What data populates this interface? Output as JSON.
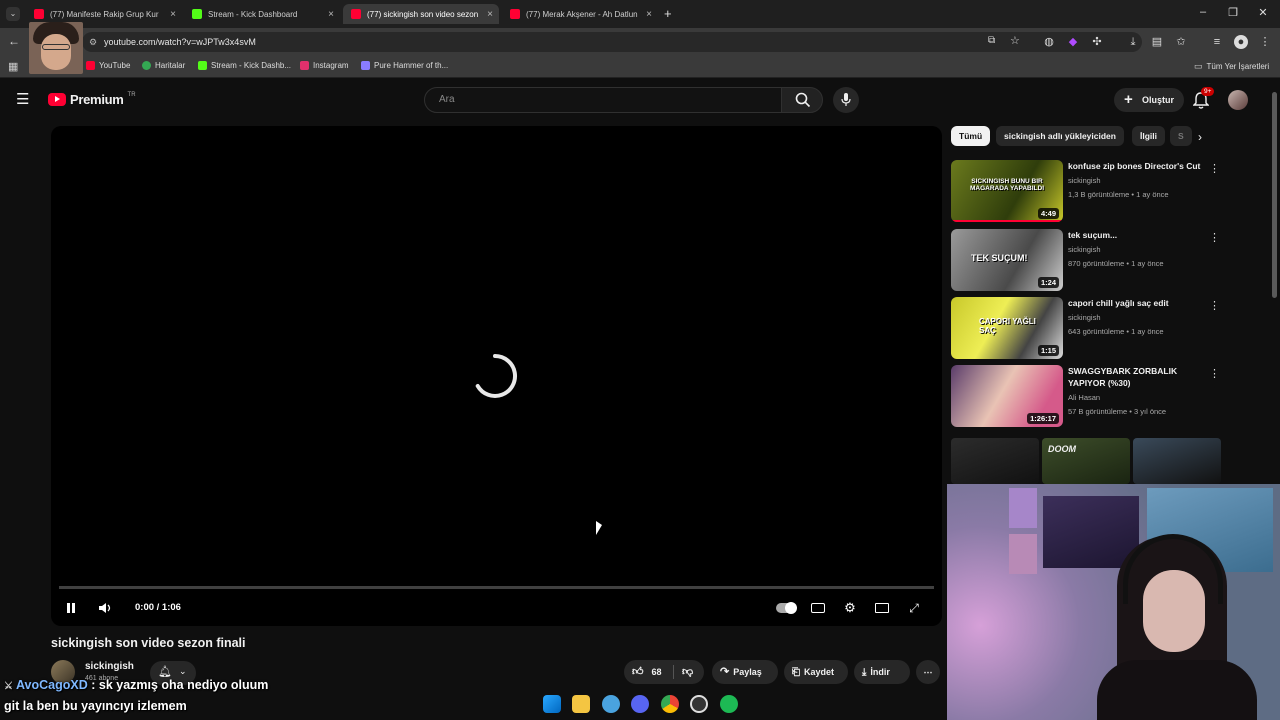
{
  "browser": {
    "tabs": [
      {
        "title": "(77) Manifeste Rakip Grup Kur",
        "active": false,
        "favicon_color": "#ff0033"
      },
      {
        "title": "Stream - Kick Dashboard",
        "active": false,
        "favicon_color": "#53fc18"
      },
      {
        "title": "(77) sickingish son video sezon",
        "active": true,
        "favicon_color": "#ff0033"
      },
      {
        "title": "(77) Merak Akşener - Ah Datlun",
        "active": false,
        "favicon_color": "#ff0033"
      }
    ],
    "new_tab": "+",
    "url": "youtube.com/watch?v=wJPTw3x4svM",
    "bookmarks": [
      "YouTube",
      "Haritalar",
      "Stream - Kick Dashb...",
      "Instagram",
      "Pure Hammer of th..."
    ],
    "all_bookmarks": "Tüm Yer İşaretleri"
  },
  "youtube": {
    "logo": "Premium",
    "region": "TR",
    "search_placeholder": "Ara",
    "create_label": "Oluştur",
    "notif_badge": "9+",
    "accent_color": "#ff0033"
  },
  "player": {
    "time": "0:00 / 1:06",
    "progress": 0
  },
  "video": {
    "title": "sickingish son video sezon finali",
    "channel": "sickingish",
    "subscribers": "461 abone",
    "likes": "68",
    "share_label": "Paylaş",
    "save_label": "Kaydet",
    "download_label": "İndir"
  },
  "sidebar": {
    "chips": [
      "Tümü",
      "sickingish adlı yükleyiciden",
      "İlgili",
      "S"
    ],
    "recs": [
      {
        "title": "konfuse zip bones Director's Cut",
        "channel": "sickingish",
        "meta": "1,3 B görüntüleme • 1 ay önce",
        "duration": "4:49",
        "thumb_text": "SICKINGISH BUNU BIR MAGARADA YAPABILDI"
      },
      {
        "title": "tek suçum...",
        "channel": "sickingish",
        "meta": "870 görüntüleme • 1 ay önce",
        "duration": "1:24",
        "thumb_text": "TEK SUÇUM!"
      },
      {
        "title": "capori chill yağlı saç edit",
        "channel": "sickingish",
        "meta": "643 görüntüleme • 1 ay önce",
        "duration": "1:15",
        "thumb_text": "CAPORI YAĞLI SAÇ"
      },
      {
        "title": "SWAGGYBARK ZORBALIK YAPIYOR (%30)",
        "channel": "Ali Hasan",
        "meta": "57 B görüntüleme • 3 yıl önce",
        "duration": "1:26:17",
        "thumb_text": ""
      }
    ],
    "shorts_label": "DOOM"
  },
  "chat": [
    {
      "user": "AvoCagoXD",
      "message": ": sk yazmış oha nediyo oluum"
    },
    {
      "user": "",
      "message": "git la ben bu yayıncıyı izlemem"
    }
  ]
}
